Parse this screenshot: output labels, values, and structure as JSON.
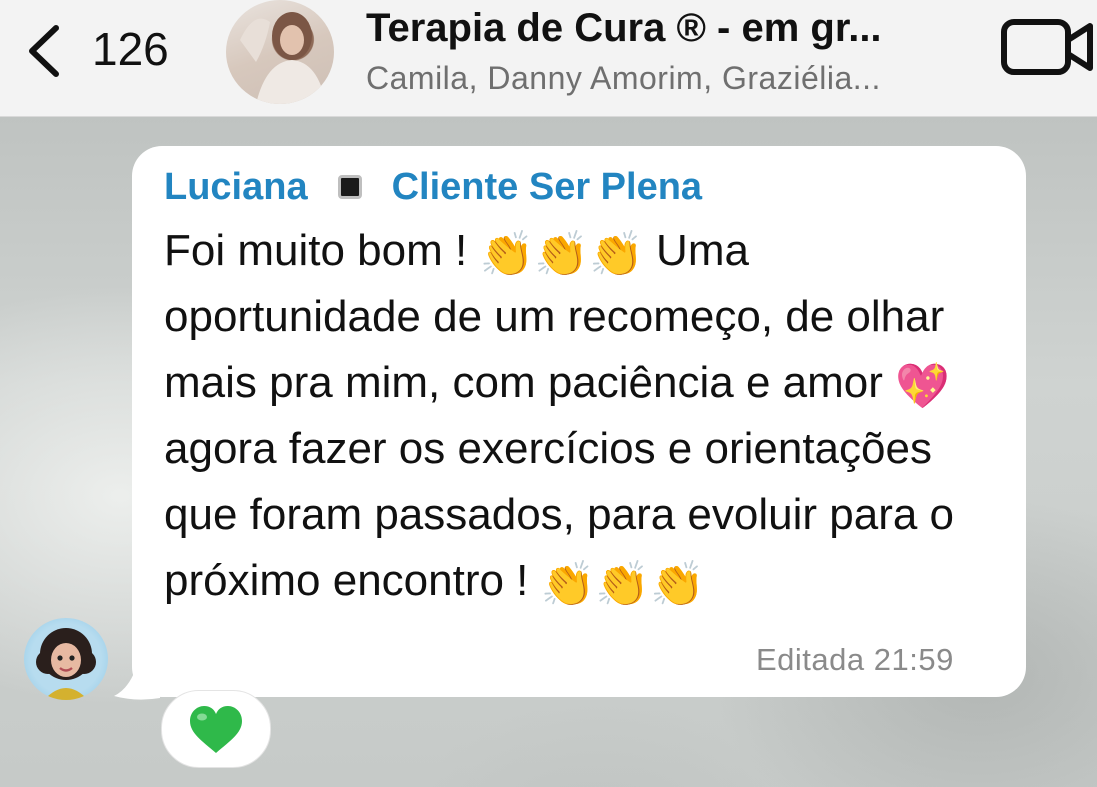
{
  "header": {
    "back_count": "126",
    "title": "Terapia de Cura ®  - em gr...",
    "subtitle": "Camila, Danny Amorim, Graziélia..."
  },
  "message": {
    "sender_name": "Luciana",
    "sender_tag": "Cliente Ser Plena",
    "text_part1": "Foi muito bom ! ",
    "emoji_clap": "👏",
    "text_part2": " Uma oportunidade de um recomeço, de olhar mais pra mim, com paciência e amor ",
    "emoji_heart": "💖",
    "text_part3": " agora fazer os exercícios e orientações que foram passados, para evoluir para o próximo encontro ! ",
    "edited_label": "Editada",
    "time": "21:59",
    "reaction": "💚"
  },
  "icons": {
    "back": "chevron-left-icon",
    "video": "video-camera-icon"
  },
  "colors": {
    "sender_name": "#2285c1",
    "header_bg": "#f3f3f3",
    "bubble_bg": "#ffffff",
    "meta_text": "#8a8a8a"
  }
}
